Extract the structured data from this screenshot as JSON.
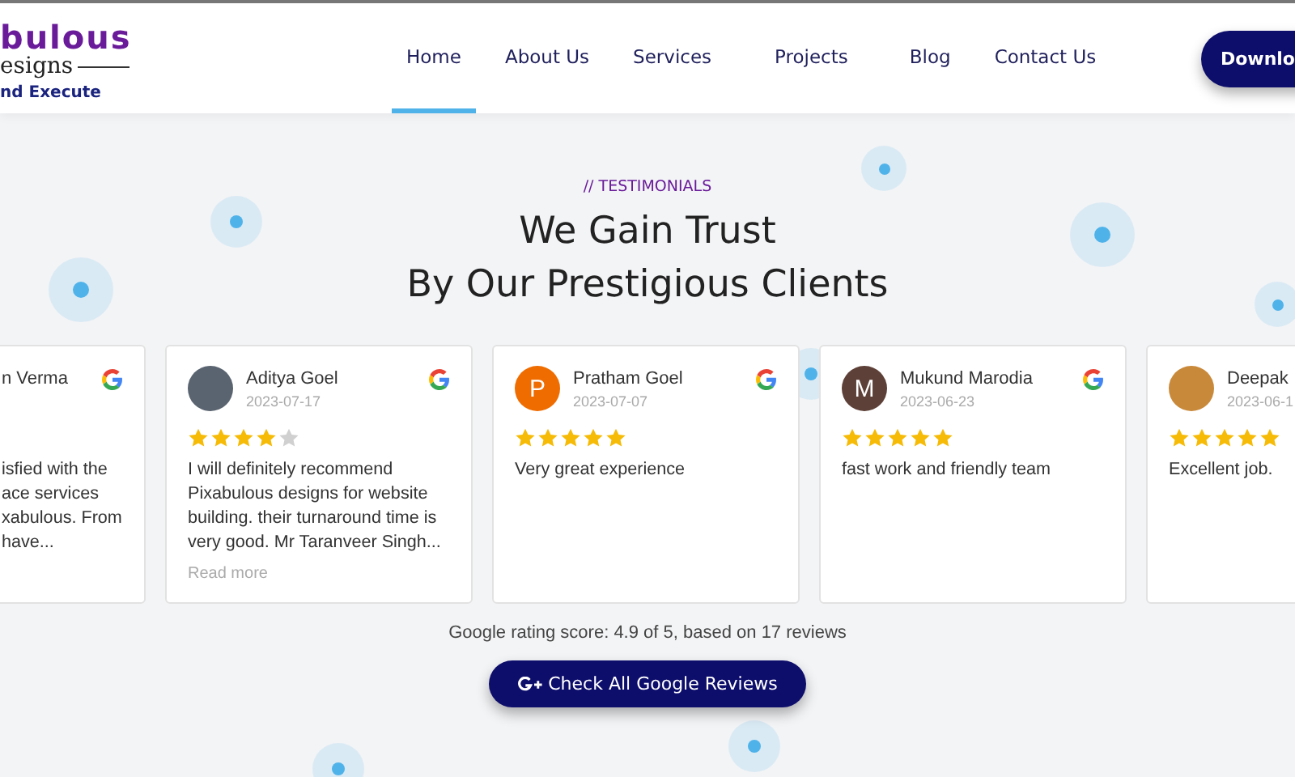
{
  "logo": {
    "line_1": "bulous",
    "line_2": "esigns",
    "line_3": "nd Execute"
  },
  "nav": [
    {
      "label": "Home",
      "selected": true
    },
    {
      "label": "About Us",
      "selected": false
    },
    {
      "label": "Services",
      "selected": false
    },
    {
      "label": "Projects",
      "selected": false
    },
    {
      "label": "Blog",
      "selected": false
    },
    {
      "label": "Contact Us",
      "selected": false
    }
  ],
  "download_button": "Downlo",
  "section": {
    "eyebrow": "// TESTIMONIALS",
    "title_line_1": "We Gain Trust",
    "title_line_2": "By Our Prestigious Clients"
  },
  "reviews": [
    {
      "name": "n Verma",
      "avatar": {
        "kind": "none"
      },
      "text": "isfied with the\nace services\nxabulous. From\nhave..."
    },
    {
      "name": "Aditya Goel",
      "date": "2023-07-17",
      "avatar": {
        "kind": "photo"
      },
      "stars": 4,
      "text": "I will definitely recommend Pixabulous designs for website building. their turnaround time is very good. Mr Taranveer Singh...",
      "read_more": "Read more"
    },
    {
      "name": "Pratham Goel",
      "date": "2023-07-07",
      "avatar": {
        "kind": "letter",
        "letter": "P",
        "color": "#ef6c00"
      },
      "stars": 5,
      "text": "Very great experience"
    },
    {
      "name": "Mukund Marodia",
      "date": "2023-06-23",
      "avatar": {
        "kind": "letter",
        "letter": "M",
        "color": "#5d4037"
      },
      "stars": 5,
      "text": "fast work and friendly team"
    },
    {
      "name": "Deepak",
      "date": "2023-06-1",
      "avatar": {
        "kind": "photo"
      },
      "stars": 5,
      "text": "Excellent job."
    }
  ],
  "rating_summary": "Google rating score: 4.9 of 5, based on 17 reviews",
  "cta_button": "Check All Google Reviews"
}
